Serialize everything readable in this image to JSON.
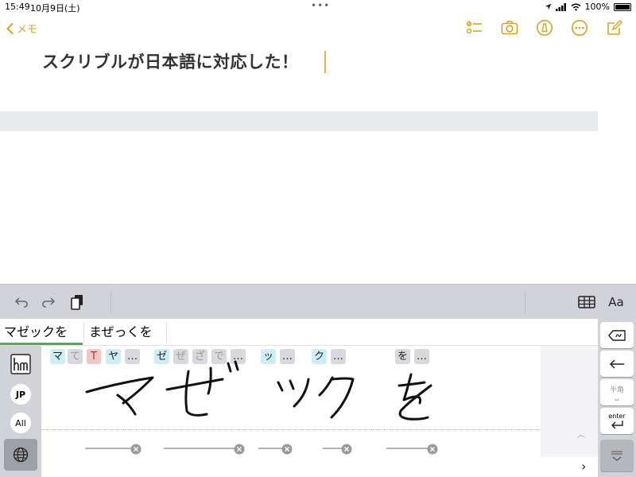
{
  "status": {
    "time": "15:49",
    "date": "10月9日(土)",
    "battery_text": "100%"
  },
  "nav": {
    "back_label": "メモ",
    "accent_color": "#d9a31a",
    "icons": [
      "checklist-icon",
      "camera-icon",
      "markup-icon",
      "more-icon",
      "compose-icon"
    ]
  },
  "note": {
    "title": "スクリブルが日本語に対応した！"
  },
  "toolbar": {
    "aa_label": "Aa"
  },
  "candidates": {
    "items": [
      "マゼックを",
      "まぜっくを"
    ]
  },
  "left_panel": {
    "jp_label": "JP",
    "all_label": "All"
  },
  "handwriting": {
    "groups": [
      {
        "chips": [
          "マ",
          "て",
          "T",
          "ヤ",
          "…"
        ]
      },
      {
        "chips": [
          "ゼ",
          "ぜ",
          "ざ",
          "で",
          "…"
        ]
      },
      {
        "chips": [
          "ッ",
          "…"
        ]
      },
      {
        "chips": [
          "ク",
          "…"
        ]
      },
      {
        "chips": [
          "を",
          "…"
        ]
      }
    ]
  },
  "right_keys": {
    "hankaku_label": "半角",
    "enter_label": "enter"
  }
}
